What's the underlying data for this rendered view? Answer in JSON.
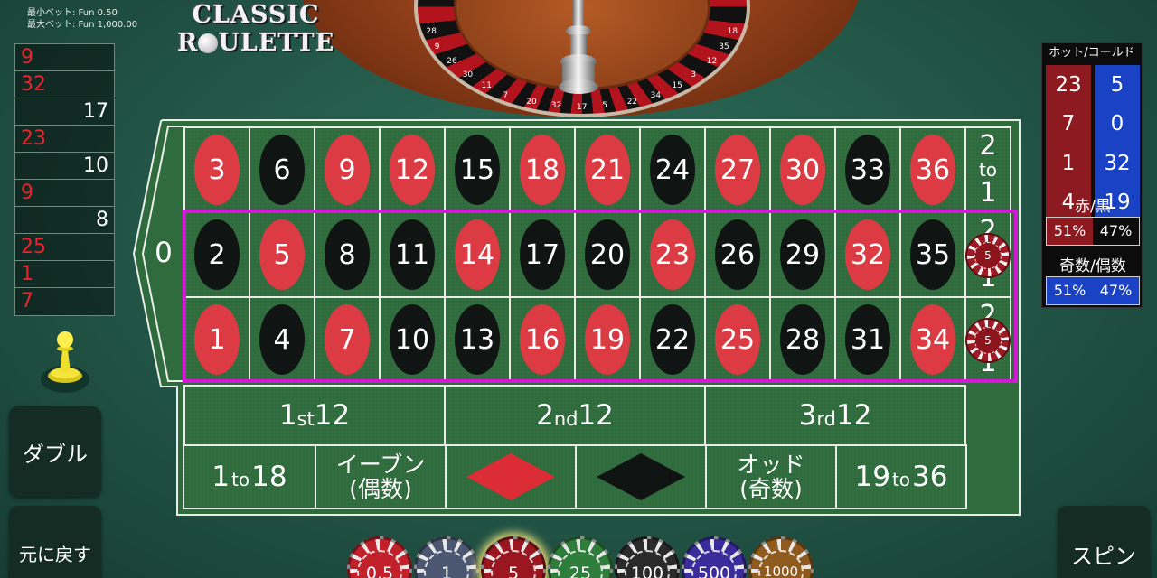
{
  "limits": {
    "min_bet": "最小ベット: Fun 0.50",
    "max_bet": "最大ベット: Fun 1,000.00"
  },
  "logo": {
    "line1": "CLASSIC",
    "line2_pre": "R",
    "line2_post": "ULETTE"
  },
  "history": [
    {
      "value": "9",
      "color": "red"
    },
    {
      "value": "32",
      "color": "red"
    },
    {
      "value": "17",
      "color": "black"
    },
    {
      "value": "23",
      "color": "red"
    },
    {
      "value": "10",
      "color": "black"
    },
    {
      "value": "9",
      "color": "red"
    },
    {
      "value": "8",
      "color": "black"
    },
    {
      "value": "25",
      "color": "red"
    },
    {
      "value": "1",
      "color": "red"
    },
    {
      "value": "7",
      "color": "red"
    }
  ],
  "buttons": {
    "double": "ダブル",
    "undo": "元に戻す",
    "spin": "スピン"
  },
  "hot_cold": {
    "title": "ホット/コールド",
    "hot": [
      "23",
      "7",
      "1",
      "4"
    ],
    "cold": [
      "5",
      "0",
      "32",
      "19"
    ],
    "red_black_label": "赤/黒",
    "red_pct": "51%",
    "black_pct": "47%",
    "odd_even_label": "奇数/偶数",
    "odd_pct": "51%",
    "even_pct": "47%"
  },
  "table": {
    "zero": "0",
    "rows": [
      [
        {
          "n": "3",
          "c": "red"
        },
        {
          "n": "6",
          "c": "black"
        },
        {
          "n": "9",
          "c": "red"
        },
        {
          "n": "12",
          "c": "red"
        },
        {
          "n": "15",
          "c": "black"
        },
        {
          "n": "18",
          "c": "red"
        },
        {
          "n": "21",
          "c": "red"
        },
        {
          "n": "24",
          "c": "black"
        },
        {
          "n": "27",
          "c": "red"
        },
        {
          "n": "30",
          "c": "red"
        },
        {
          "n": "33",
          "c": "black"
        },
        {
          "n": "36",
          "c": "red"
        }
      ],
      [
        {
          "n": "2",
          "c": "black"
        },
        {
          "n": "5",
          "c": "red"
        },
        {
          "n": "8",
          "c": "black"
        },
        {
          "n": "11",
          "c": "black"
        },
        {
          "n": "14",
          "c": "red"
        },
        {
          "n": "17",
          "c": "black"
        },
        {
          "n": "20",
          "c": "black"
        },
        {
          "n": "23",
          "c": "red"
        },
        {
          "n": "26",
          "c": "black"
        },
        {
          "n": "29",
          "c": "black"
        },
        {
          "n": "32",
          "c": "red"
        },
        {
          "n": "35",
          "c": "black"
        }
      ],
      [
        {
          "n": "1",
          "c": "red"
        },
        {
          "n": "4",
          "c": "black"
        },
        {
          "n": "7",
          "c": "red"
        },
        {
          "n": "10",
          "c": "black"
        },
        {
          "n": "13",
          "c": "black"
        },
        {
          "n": "16",
          "c": "red"
        },
        {
          "n": "19",
          "c": "red"
        },
        {
          "n": "22",
          "c": "black"
        },
        {
          "n": "25",
          "c": "red"
        },
        {
          "n": "28",
          "c": "black"
        },
        {
          "n": "31",
          "c": "black"
        },
        {
          "n": "34",
          "c": "red"
        }
      ]
    ],
    "column_bet": {
      "top": "2",
      "mid": "to",
      "bottom": "1"
    },
    "dozens": [
      {
        "pre": "1",
        "suf": "st",
        "post": "12"
      },
      {
        "pre": "2",
        "suf": "nd",
        "post": "12"
      },
      {
        "pre": "3",
        "suf": "rd",
        "post": "12"
      }
    ],
    "low": {
      "a": "1",
      "to": "to",
      "b": "18"
    },
    "even": {
      "line1": "イーブン",
      "line2": "(偶数)"
    },
    "odd": {
      "line1": "オッド",
      "line2": "(奇数)"
    },
    "high": {
      "a": "19",
      "to": "to",
      "b": "36"
    },
    "placed_chip_value": "5"
  },
  "chips": [
    {
      "label": "0.5",
      "color": "#c2212c"
    },
    {
      "label": "1",
      "color": "#4b5670"
    },
    {
      "label": "5",
      "color": "#9a1620",
      "selected": true
    },
    {
      "label": "25",
      "color": "#2f7d3a"
    },
    {
      "label": "100",
      "color": "#2a2a2a"
    },
    {
      "label": "500",
      "color": "#3b2c9b"
    },
    {
      "label": "1000",
      "color": "#8f5a1d"
    }
  ],
  "wheel_numbers": [
    "28",
    "9",
    "26",
    "30",
    "11",
    "7",
    "20",
    "32",
    "17",
    "5",
    "22",
    "34",
    "15",
    "3",
    "12",
    "35",
    "18"
  ]
}
